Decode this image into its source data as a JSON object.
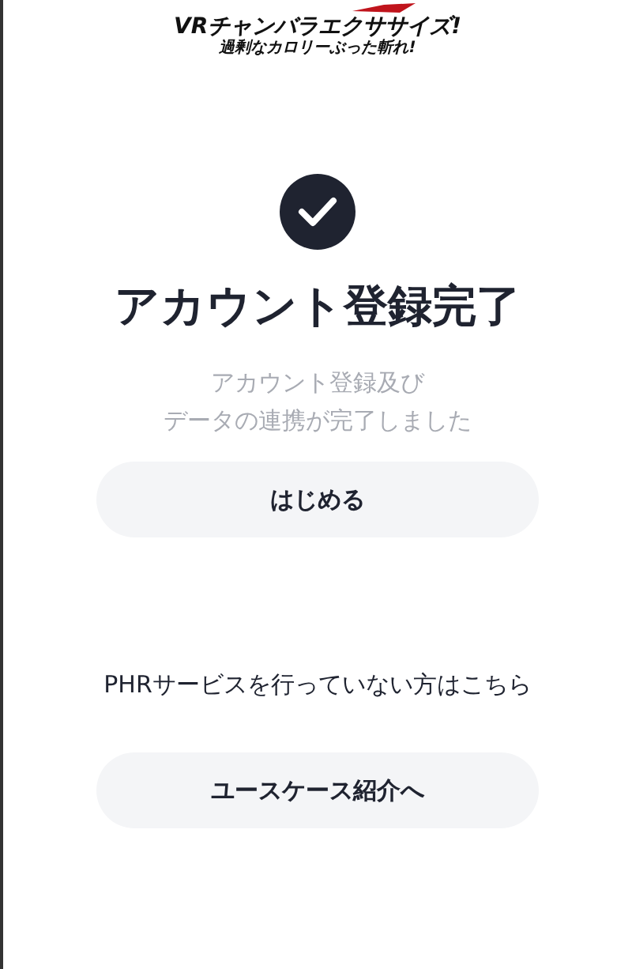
{
  "logo": {
    "title": "VRチャンバラエクササイズ!",
    "tagline": "過剰なカロリーぶった斬れ!"
  },
  "heading": "アカウント登録完了",
  "message": [
    "アカウント登録及び",
    "データの連携が完了しました"
  ],
  "start_button": "はじめる",
  "no_phr_text": "PHRサービスを行っていない方はこちら",
  "use_case_button": "ユースケース紹介へ"
}
